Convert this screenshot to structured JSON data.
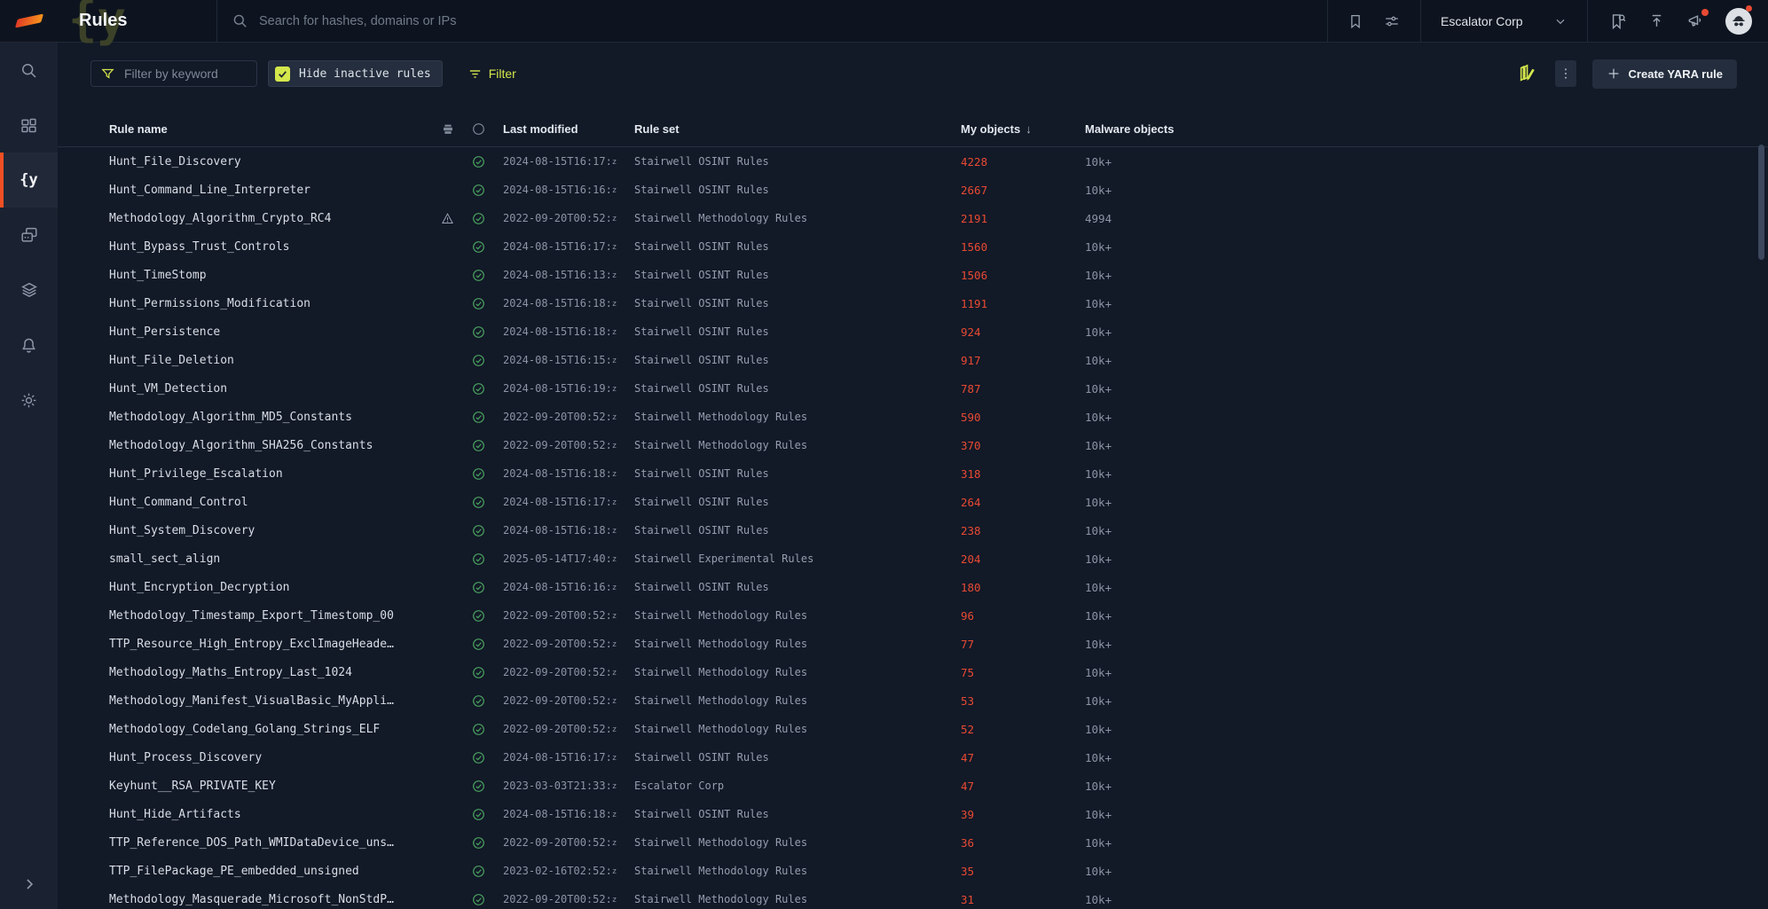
{
  "colors": {
    "bg": "#121927",
    "topbar-bg": "#0e141f",
    "accent": "#d4e74b",
    "red": "#e84a33",
    "green": "#4aa05f",
    "orange": "#f04f23",
    "orange-deep": "#e03a24"
  },
  "topbar": {
    "title": "Rules",
    "watermark": "{y",
    "search_placeholder": "Search for hashes, domains or IPs",
    "org_name": "Escalator Corp"
  },
  "sidebar": {
    "yara_glyph": "{y",
    "items": [
      {
        "icon": "search-icon"
      },
      {
        "icon": "dashboard-icon"
      },
      {
        "icon": "yara-rules-icon",
        "active": true
      },
      {
        "icon": "assets-icon"
      },
      {
        "icon": "layers-icon"
      },
      {
        "icon": "bell-icon"
      },
      {
        "icon": "gear-icon"
      }
    ]
  },
  "filterbar": {
    "keyword_placeholder": "Filter by keyword",
    "hide_inactive_label": "Hide inactive rules",
    "hide_inactive_checked": true,
    "filter_label": "Filter",
    "create_label": "Create YARA rule"
  },
  "table": {
    "columns": {
      "rule_name": "Rule name",
      "last_modified": "Last modified",
      "rule_set": "Rule set",
      "my_objects": "My objects",
      "malware_objects": "Malware objects"
    },
    "sort_indicator": "↓",
    "ts_suffix": "z",
    "rows": [
      {
        "name": "Hunt_File_Discovery",
        "warning": false,
        "modified": "2024-08-15T16:17:",
        "rule_set": "Stairwell OSINT Rules",
        "my_objects": "4228",
        "malware_objects": "10k+"
      },
      {
        "name": "Hunt_Command_Line_Interpreter",
        "warning": false,
        "modified": "2024-08-15T16:16:",
        "rule_set": "Stairwell OSINT Rules",
        "my_objects": "2667",
        "malware_objects": "10k+"
      },
      {
        "name": "Methodology_Algorithm_Crypto_RC4",
        "warning": true,
        "modified": "2022-09-20T00:52:",
        "rule_set": "Stairwell Methodology Rules",
        "my_objects": "2191",
        "malware_objects": "4994"
      },
      {
        "name": "Hunt_Bypass_Trust_Controls",
        "warning": false,
        "modified": "2024-08-15T16:17:",
        "rule_set": "Stairwell OSINT Rules",
        "my_objects": "1560",
        "malware_objects": "10k+"
      },
      {
        "name": "Hunt_TimeStomp",
        "warning": false,
        "modified": "2024-08-15T16:13:",
        "rule_set": "Stairwell OSINT Rules",
        "my_objects": "1506",
        "malware_objects": "10k+"
      },
      {
        "name": "Hunt_Permissions_Modification",
        "warning": false,
        "modified": "2024-08-15T16:18:",
        "rule_set": "Stairwell OSINT Rules",
        "my_objects": "1191",
        "malware_objects": "10k+"
      },
      {
        "name": "Hunt_Persistence",
        "warning": false,
        "modified": "2024-08-15T16:18:",
        "rule_set": "Stairwell OSINT Rules",
        "my_objects": "924",
        "malware_objects": "10k+"
      },
      {
        "name": "Hunt_File_Deletion",
        "warning": false,
        "modified": "2024-08-15T16:15:",
        "rule_set": "Stairwell OSINT Rules",
        "my_objects": "917",
        "malware_objects": "10k+"
      },
      {
        "name": "Hunt_VM_Detection",
        "warning": false,
        "modified": "2024-08-15T16:19:",
        "rule_set": "Stairwell OSINT Rules",
        "my_objects": "787",
        "malware_objects": "10k+"
      },
      {
        "name": "Methodology_Algorithm_MD5_Constants",
        "warning": false,
        "modified": "2022-09-20T00:52:",
        "rule_set": "Stairwell Methodology Rules",
        "my_objects": "590",
        "malware_objects": "10k+"
      },
      {
        "name": "Methodology_Algorithm_SHA256_Constants",
        "warning": false,
        "modified": "2022-09-20T00:52:",
        "rule_set": "Stairwell Methodology Rules",
        "my_objects": "370",
        "malware_objects": "10k+"
      },
      {
        "name": "Hunt_Privilege_Escalation",
        "warning": false,
        "modified": "2024-08-15T16:18:",
        "rule_set": "Stairwell OSINT Rules",
        "my_objects": "318",
        "malware_objects": "10k+"
      },
      {
        "name": "Hunt_Command_Control",
        "warning": false,
        "modified": "2024-08-15T16:17:",
        "rule_set": "Stairwell OSINT Rules",
        "my_objects": "264",
        "malware_objects": "10k+"
      },
      {
        "name": "Hunt_System_Discovery",
        "warning": false,
        "modified": "2024-08-15T16:18:",
        "rule_set": "Stairwell OSINT Rules",
        "my_objects": "238",
        "malware_objects": "10k+"
      },
      {
        "name": "small_sect_align",
        "warning": false,
        "modified": "2025-05-14T17:40:",
        "rule_set": "Stairwell Experimental Rules",
        "my_objects": "204",
        "malware_objects": "10k+"
      },
      {
        "name": "Hunt_Encryption_Decryption",
        "warning": false,
        "modified": "2024-08-15T16:16:",
        "rule_set": "Stairwell OSINT Rules",
        "my_objects": "180",
        "malware_objects": "10k+"
      },
      {
        "name": "Methodology_Timestamp_Export_Timestomp_00",
        "warning": false,
        "modified": "2022-09-20T00:52:",
        "rule_set": "Stairwell Methodology Rules",
        "my_objects": "96",
        "malware_objects": "10k+"
      },
      {
        "name": "TTP_Resource_High_Entropy_ExclImageHeade…",
        "warning": false,
        "modified": "2022-09-20T00:52:",
        "rule_set": "Stairwell Methodology Rules",
        "my_objects": "77",
        "malware_objects": "10k+"
      },
      {
        "name": "Methodology_Maths_Entropy_Last_1024",
        "warning": false,
        "modified": "2022-09-20T00:52:",
        "rule_set": "Stairwell Methodology Rules",
        "my_objects": "75",
        "malware_objects": "10k+"
      },
      {
        "name": "Methodology_Manifest_VisualBasic_MyAppli…",
        "warning": false,
        "modified": "2022-09-20T00:52:",
        "rule_set": "Stairwell Methodology Rules",
        "my_objects": "53",
        "malware_objects": "10k+"
      },
      {
        "name": "Methodology_Codelang_Golang_Strings_ELF",
        "warning": false,
        "modified": "2022-09-20T00:52:",
        "rule_set": "Stairwell Methodology Rules",
        "my_objects": "52",
        "malware_objects": "10k+"
      },
      {
        "name": "Hunt_Process_Discovery",
        "warning": false,
        "modified": "2024-08-15T16:17:",
        "rule_set": "Stairwell OSINT Rules",
        "my_objects": "47",
        "malware_objects": "10k+"
      },
      {
        "name": "Keyhunt__RSA_PRIVATE_KEY",
        "warning": false,
        "modified": "2023-03-03T21:33:",
        "rule_set": "Escalator Corp",
        "my_objects": "47",
        "malware_objects": "10k+"
      },
      {
        "name": "Hunt_Hide_Artifacts",
        "warning": false,
        "modified": "2024-08-15T16:18:",
        "rule_set": "Stairwell OSINT Rules",
        "my_objects": "39",
        "malware_objects": "10k+"
      },
      {
        "name": "TTP_Reference_DOS_Path_WMIDataDevice_uns…",
        "warning": false,
        "modified": "2022-09-20T00:52:",
        "rule_set": "Stairwell Methodology Rules",
        "my_objects": "36",
        "malware_objects": "10k+"
      },
      {
        "name": "TTP_FilePackage_PE_embedded_unsigned",
        "warning": false,
        "modified": "2023-02-16T02:52:",
        "rule_set": "Stairwell Methodology Rules",
        "my_objects": "35",
        "malware_objects": "10k+"
      },
      {
        "name": "Methodology_Masquerade_Microsoft_NonStdP…",
        "warning": false,
        "modified": "2022-09-20T00:52:",
        "rule_set": "Stairwell Methodology Rules",
        "my_objects": "31",
        "malware_objects": "10k+"
      }
    ]
  }
}
